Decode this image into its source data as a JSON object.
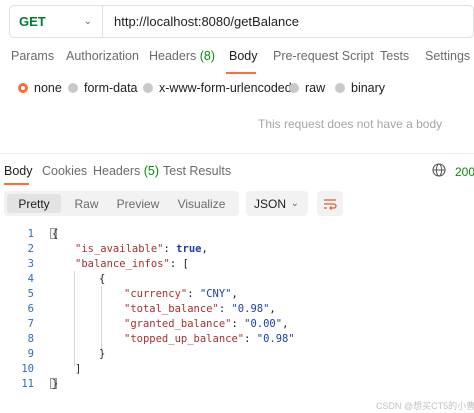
{
  "request": {
    "method": "GET",
    "url": "http://localhost:8080/getBalance"
  },
  "request_tabs": {
    "params": "Params",
    "authorization": "Authorization",
    "headers": "Headers",
    "headers_count": "(8)",
    "body": "Body",
    "prerequest": "Pre-request Script",
    "tests": "Tests",
    "settings": "Settings"
  },
  "body_options": {
    "none": "none",
    "form_data": "form-data",
    "urlencoded": "x-www-form-urlencoded",
    "raw": "raw",
    "binary": "binary",
    "selected": "none"
  },
  "empty_body_message": "This request does not have a body",
  "response_tabs": {
    "body": "Body",
    "cookies": "Cookies",
    "headers": "Headers",
    "headers_count": "(5)",
    "test_results": "Test Results",
    "status": "200"
  },
  "view_modes": {
    "pretty": "Pretty",
    "raw": "Raw",
    "preview": "Preview",
    "visualize": "Visualize",
    "format": "JSON"
  },
  "line_numbers": [
    "1",
    "2",
    "3",
    "4",
    "5",
    "6",
    "7",
    "8",
    "9",
    "10",
    "11"
  ],
  "response_json": {
    "open_brace": "{",
    "is_available_key": "\"is_available\"",
    "is_available_value": "true",
    "balance_infos_key": "\"balance_infos\"",
    "array_open": "[",
    "obj_open": "{",
    "currency_key": "\"currency\"",
    "currency_value": "\"CNY\"",
    "total_balance_key": "\"total_balance\"",
    "total_balance_value": "\"0.98\"",
    "granted_balance_key": "\"granted_balance\"",
    "granted_balance_value": "\"0.00\"",
    "topped_up_balance_key": "\"topped_up_balance\"",
    "topped_up_balance_value": "\"0.98\"",
    "obj_close": "}",
    "array_close": "]",
    "close_brace": "}"
  },
  "watermark": "CSDN @想买CT5的小曹",
  "colors": {
    "accent": "#ff6c37",
    "method_get": "#007f31",
    "status_ok": "#0a8a0a",
    "json_key": "#a8302f",
    "json_string": "#1b3fa6"
  },
  "icons": [
    "chevron-down-icon",
    "globe-icon",
    "wrap-lines-icon"
  ]
}
